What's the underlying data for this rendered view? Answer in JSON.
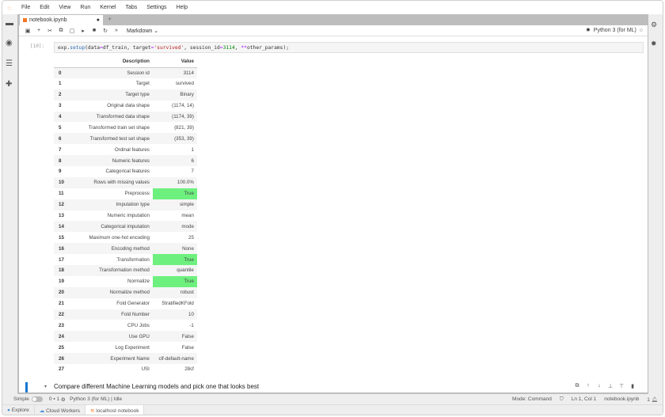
{
  "menu": [
    "File",
    "Edit",
    "View",
    "Run",
    "Kernel",
    "Tabs",
    "Settings",
    "Help"
  ],
  "tab": {
    "title": "notebook.ipynb",
    "modified": "●",
    "new_tab": "+"
  },
  "toolbar": {
    "cell_type": "Markdown ⌄",
    "kernel": "Python 3 (for ML)"
  },
  "cell": {
    "prompt": "[10]:",
    "code": {
      "a": "exp.",
      "b": "setup",
      "c": "(data",
      "d": "=",
      "e": "df_train, target",
      "f": "=",
      "g": "'survived'",
      "h": ", session_id",
      "i": "=",
      "j": "3114",
      "k": ", ",
      "l": "**",
      "m": "other_params);"
    }
  },
  "table": {
    "headers": [
      "",
      "Description",
      "Value"
    ],
    "rows": [
      [
        "0",
        "Session id",
        "3114"
      ],
      [
        "1",
        "Target",
        "survived"
      ],
      [
        "2",
        "Target type",
        "Binary"
      ],
      [
        "3",
        "Original data shape",
        "(1174, 14)"
      ],
      [
        "4",
        "Transformed data shape",
        "(1174, 39)"
      ],
      [
        "5",
        "Transformed train set shape",
        "(821, 39)"
      ],
      [
        "6",
        "Transformed test set shape",
        "(353, 39)"
      ],
      [
        "7",
        "Ordinal features",
        "1"
      ],
      [
        "8",
        "Numeric features",
        "6"
      ],
      [
        "9",
        "Categorical features",
        "7"
      ],
      [
        "10",
        "Rows with missing values",
        "100.0%"
      ],
      [
        "11",
        "Preprocess",
        "True"
      ],
      [
        "12",
        "Imputation type",
        "simple"
      ],
      [
        "13",
        "Numeric imputation",
        "mean"
      ],
      [
        "14",
        "Categorical imputation",
        "mode"
      ],
      [
        "15",
        "Maximum one-hot encoding",
        "25"
      ],
      [
        "16",
        "Encoding method",
        "None"
      ],
      [
        "17",
        "Transformation",
        "True"
      ],
      [
        "18",
        "Transformation method",
        "quantile"
      ],
      [
        "19",
        "Normalize",
        "True"
      ],
      [
        "20",
        "Normalize method",
        "robust"
      ],
      [
        "21",
        "Fold Generator",
        "StratifiedKFold"
      ],
      [
        "22",
        "Fold Number",
        "10"
      ],
      [
        "23",
        "CPU Jobs",
        "-1"
      ],
      [
        "24",
        "Use GPU",
        "False"
      ],
      [
        "25",
        "Log Experiment",
        "False"
      ],
      [
        "26",
        "Experiment Name",
        "clf-default-name"
      ],
      [
        "27",
        "USI",
        "28cf"
      ]
    ],
    "highlight_color": "#6ef07e"
  },
  "markdown": {
    "text": "Compare different Machine Learning models and pick one that looks best"
  },
  "status": {
    "mode_label": "Simple",
    "terminals": "0",
    "kernels": "1",
    "kernel_status": "Python 3 (for ML) | Idle",
    "mode": "Mode: Command",
    "position": "Ln 1, Col 1",
    "file": "notebook.ipynb",
    "notifications": "1"
  },
  "bottom_tabs": [
    "Explore",
    "Cloud Workers",
    "localhost notebook"
  ]
}
